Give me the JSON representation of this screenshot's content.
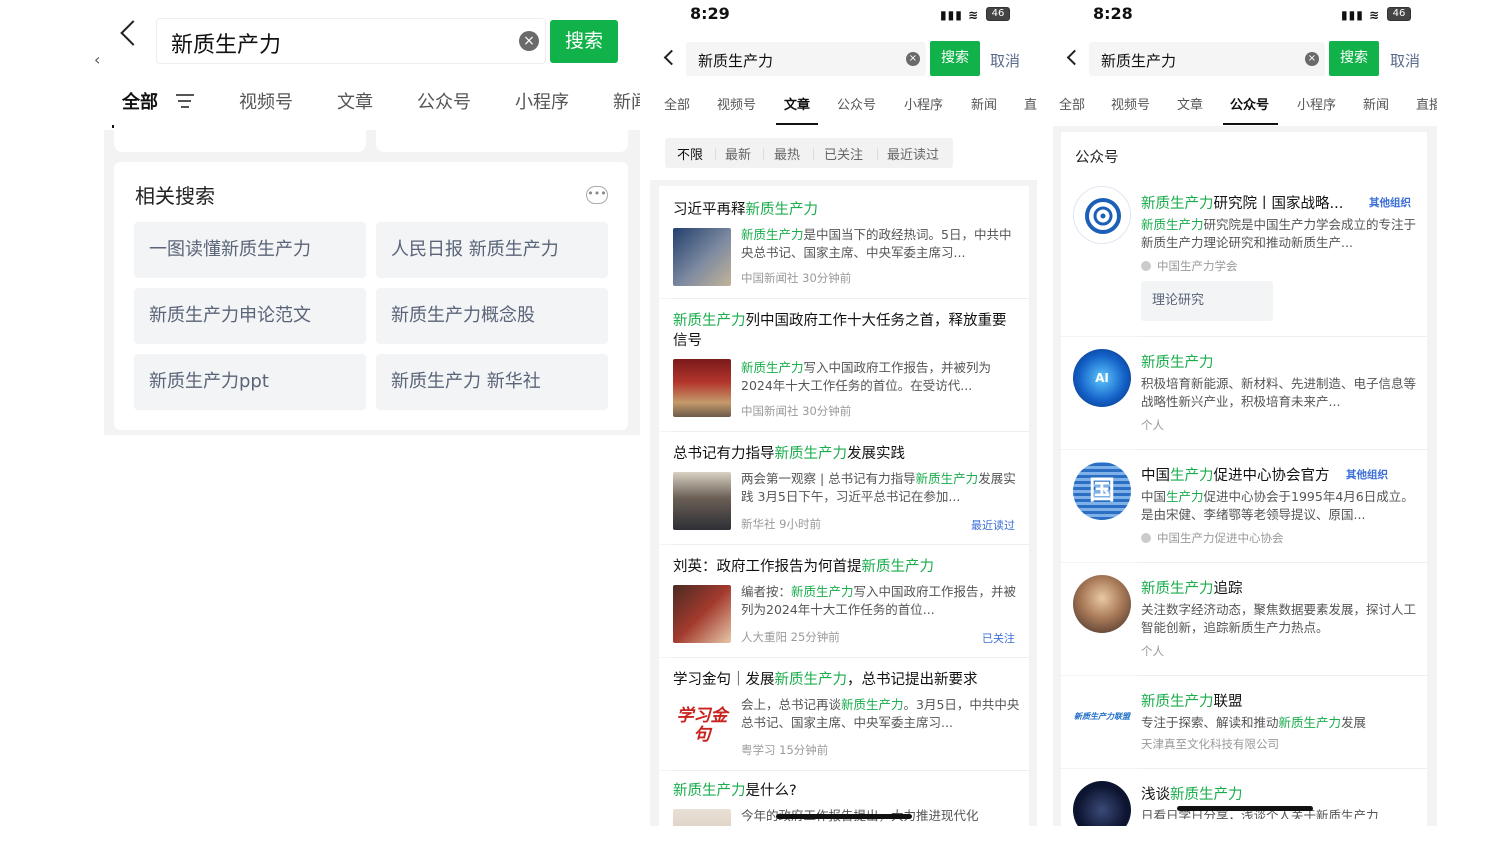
{
  "p1": {
    "query": "新质生产力",
    "search_label": "搜索",
    "tabs": [
      "全部",
      "视频号",
      "文章",
      "公众号",
      "小程序",
      "新闻"
    ],
    "related_title": "相关搜索",
    "more_icon": "ellipsis-icon",
    "related": [
      "一图读懂新质生产力",
      "人民日报 新质生产力",
      "新质生产力申论范文",
      "新质生产力概念股",
      "新质生产力ppt",
      "新质生产力 新华社"
    ]
  },
  "p2": {
    "time": "8:29",
    "battery": "46",
    "query": "新质生产力",
    "search_label": "搜索",
    "cancel_label": "取消",
    "tabs": [
      "全部",
      "视频号",
      "文章",
      "公众号",
      "小程序",
      "新闻",
      "直"
    ],
    "filters": [
      "不限",
      "最新",
      "最热",
      "已关注",
      "最近读过"
    ],
    "articles": [
      {
        "title_pre": "习近平再释",
        "title_hl": "新质生产力",
        "title_post": "",
        "snip_hl": "新质生产力",
        "snip": "是中国当下的政经热词。5日，中共中央总书记、国家主席、中央军委主席习...",
        "meta": "中国新闻社 30分钟前",
        "tag": ""
      },
      {
        "title_pre": "",
        "title_hl": "新质生产力",
        "title_post": "列中国政府工作十大任务之首，释放重要信号",
        "snip_hl": "新质生产力",
        "snip": "写入中国政府工作报告，并被列为2024年十大工作任务的首位。在受访代...",
        "meta": "中国新闻社 30分钟前",
        "tag": ""
      },
      {
        "title_pre": "总书记有力指导",
        "title_hl": "新质生产力",
        "title_post": "发展实践",
        "snip_pre": "两会第一观察 | 总书记有力指导",
        "snip_hl": "新质生产力",
        "snip": "发展实践 3月5日下午，习近平总书记在参加...",
        "meta": "新华社 9小时前",
        "tag": "最近读过"
      },
      {
        "title_pre": "刘英：政府工作报告为何首提",
        "title_hl": "新质生产力",
        "title_post": "",
        "snip_pre": "编者按：",
        "snip_hl": "新质生产力",
        "snip": "写入中国政府工作报告，并被列为2024年十大工作任务的首位...",
        "meta": "人大重阳 25分钟前",
        "tag": "已关注"
      },
      {
        "title_pre": "学习金句｜发展",
        "title_hl": "新质生产力",
        "title_post": "，总书记提出新要求",
        "snip_pre": "会上，总书记再谈",
        "snip_hl": "新质生产力",
        "snip": "。3月5日，中共中央总书记、国家主席、中央军委主席习...",
        "meta": "粤学习 15分钟前",
        "tag": "",
        "thumb_text": "学习金句"
      },
      {
        "title_pre": "",
        "title_hl": "新质生产力",
        "title_post": "是什么?",
        "snip": "今年的政府工作报告提出，大力推进现代化",
        "meta": "",
        "tag": ""
      }
    ]
  },
  "p3": {
    "time": "8:28",
    "battery": "46",
    "query": "新质生产力",
    "search_label": "搜索",
    "cancel_label": "取消",
    "tabs": [
      "全部",
      "视频号",
      "文章",
      "公众号",
      "小程序",
      "新闻",
      "直播"
    ],
    "section_title": "公众号",
    "accounts": [
      {
        "name_hl": "新质生产力",
        "name_post": "研究院丨国家战略...",
        "org": "其他组织",
        "desc_hl": "新质生产力",
        "desc": "研究院是中国生产力学会成立的专注于新质生产力理论研究和推动新质生产...",
        "meta": "中国生产力学会",
        "chip": "理论研究"
      },
      {
        "name_hl": "新质生产力",
        "name_post": "",
        "org": "",
        "desc": "积极培育新能源、新材料、先进制造、电子信息等战略性新兴产业，积极培育未来产...",
        "meta": "个人",
        "avatar_text": "AI"
      },
      {
        "name_pre": "中国",
        "name_hl": "生产力",
        "name_post": "促进中心协会官方",
        "org": "其他组织",
        "desc_pre": "中国",
        "desc_hl": "生产力",
        "desc": "促进中心协会于1995年4月6日成立。是由宋健、李绪鄂等老领导提议、原国...",
        "meta": "中国生产力促进中心协会"
      },
      {
        "name_hl": "新质生产力",
        "name_post": "追踪",
        "org": "",
        "desc": "关注数字经济动态，聚焦数据要素发展，探讨人工智能创新，追踪新质生产力热点。",
        "meta": "个人"
      },
      {
        "name_hl": "新质生产力",
        "name_post": "联盟",
        "org": "",
        "desc_pre": "专注于探索、解读和推动",
        "desc_hl": "新质生产力",
        "desc": "发展",
        "meta": "天津真至文化科技有限公司",
        "avatar_text": "新质生产力联盟"
      },
      {
        "name_pre": "浅谈",
        "name_hl": "新质生产力",
        "name_post": "",
        "org": "",
        "desc": "日看日学日分享，浅谈个人关于新质生产力",
        "meta": ""
      }
    ]
  },
  "colors": {
    "accent": "#12b24b",
    "highlight": "#1aad4c",
    "link": "#3b6fd8"
  }
}
